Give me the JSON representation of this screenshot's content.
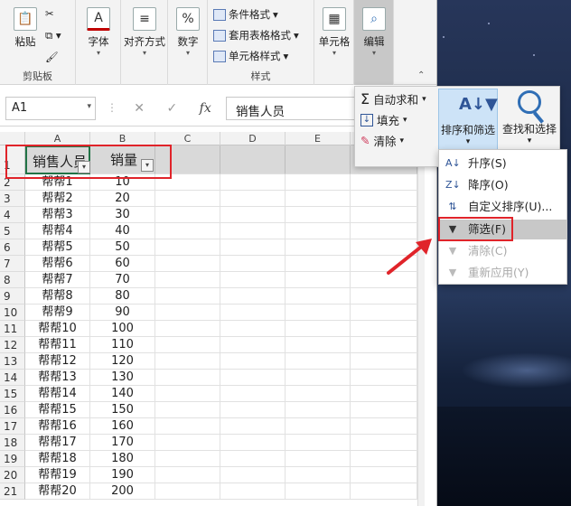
{
  "ribbon": {
    "clipboard": {
      "paste": "粘贴",
      "label": "剪贴板"
    },
    "font": {
      "label": "字体"
    },
    "alignment": {
      "label": "对齐方式"
    },
    "number": {
      "label": "数字"
    },
    "styles": {
      "conditional": "条件格式",
      "table_format": "套用表格格式",
      "cell_styles": "单元格样式",
      "label": "样式"
    },
    "cells": {
      "label": "单元格"
    },
    "editing": {
      "label": "编辑"
    }
  },
  "formula_bar": {
    "name_box": "A1",
    "fx": "fx",
    "content": "销售人员"
  },
  "grid": {
    "columns": [
      "A",
      "B",
      "C",
      "D",
      "E"
    ],
    "header_row": {
      "a": "销售人员",
      "b": "销量"
    },
    "rows": [
      {
        "n": "1"
      },
      {
        "n": "2",
        "a": "帮帮1",
        "b": "10"
      },
      {
        "n": "3",
        "a": "帮帮2",
        "b": "20"
      },
      {
        "n": "4",
        "a": "帮帮3",
        "b": "30"
      },
      {
        "n": "5",
        "a": "帮帮4",
        "b": "40"
      },
      {
        "n": "6",
        "a": "帮帮5",
        "b": "50"
      },
      {
        "n": "7",
        "a": "帮帮6",
        "b": "60"
      },
      {
        "n": "8",
        "a": "帮帮7",
        "b": "70"
      },
      {
        "n": "9",
        "a": "帮帮8",
        "b": "80"
      },
      {
        "n": "10",
        "a": "帮帮9",
        "b": "90"
      },
      {
        "n": "11",
        "a": "帮帮10",
        "b": "100"
      },
      {
        "n": "12",
        "a": "帮帮11",
        "b": "110"
      },
      {
        "n": "13",
        "a": "帮帮12",
        "b": "120"
      },
      {
        "n": "14",
        "a": "帮帮13",
        "b": "130"
      },
      {
        "n": "15",
        "a": "帮帮14",
        "b": "140"
      },
      {
        "n": "16",
        "a": "帮帮15",
        "b": "150"
      },
      {
        "n": "17",
        "a": "帮帮16",
        "b": "160"
      },
      {
        "n": "18",
        "a": "帮帮17",
        "b": "170"
      },
      {
        "n": "19",
        "a": "帮帮18",
        "b": "180"
      },
      {
        "n": "20",
        "a": "帮帮19",
        "b": "190"
      },
      {
        "n": "21",
        "a": "帮帮20",
        "b": "200"
      }
    ]
  },
  "editing_panel": {
    "autosum": "自动求和",
    "fill": "填充",
    "clear": "清除",
    "sort_filter": "排序和筛选",
    "find_select": "查找和选择"
  },
  "sort_menu": {
    "items": [
      {
        "label": "升序(S)",
        "icon": "sort-ascending-icon",
        "enabled": true
      },
      {
        "label": "降序(O)",
        "icon": "sort-descending-icon",
        "enabled": true
      },
      {
        "label": "自定义排序(U)...",
        "icon": "custom-sort-icon",
        "enabled": true
      },
      {
        "label": "筛选(F)",
        "icon": "filter-icon",
        "enabled": true,
        "highlighted": true
      },
      {
        "label": "清除(C)",
        "icon": "clear-filter-icon",
        "enabled": false
      },
      {
        "label": "重新应用(Y)",
        "icon": "reapply-icon",
        "enabled": false
      }
    ]
  },
  "colors": {
    "highlight_red": "#e0242a",
    "excel_green": "#217346",
    "accent_blue": "#2f5597"
  }
}
